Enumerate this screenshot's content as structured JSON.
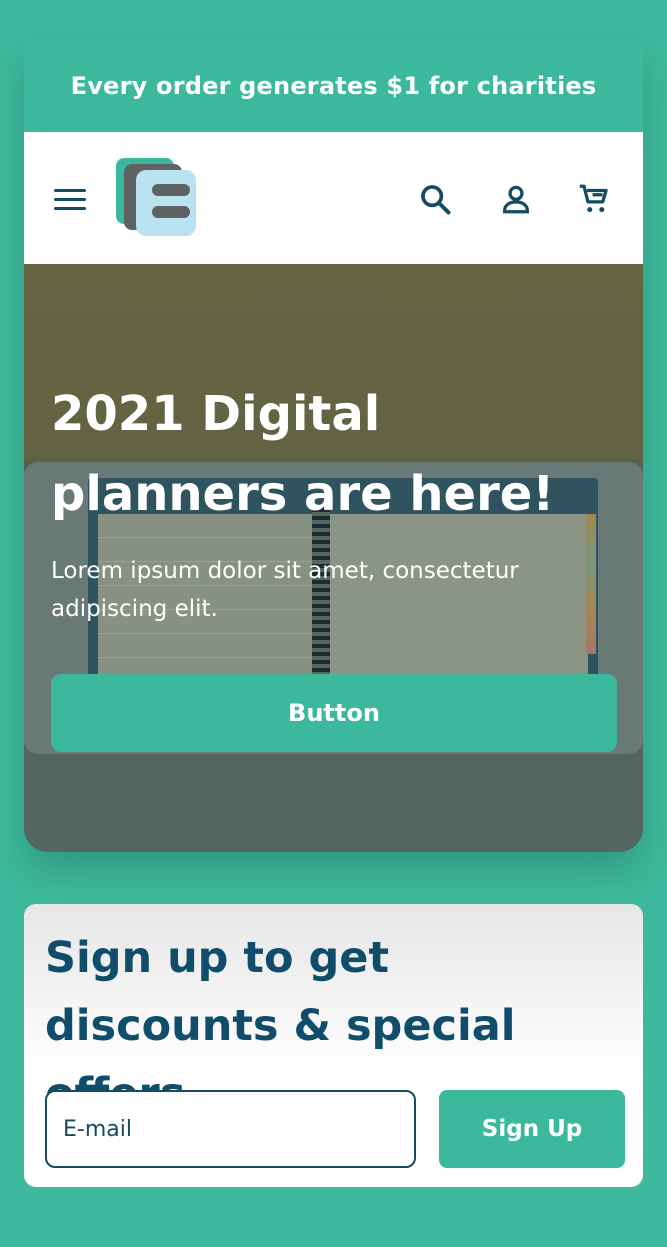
{
  "promo": {
    "text": "Every order generates $1 for charities"
  },
  "header": {
    "menu_icon": "hamburger-menu-icon",
    "logo_icon": "brand-logo",
    "search_icon": "search-icon",
    "account_icon": "user-icon",
    "cart_icon": "cart-icon"
  },
  "hero": {
    "title": "2021 Digital planners are here!",
    "subtitle": "Lorem ipsum dolor sit amet, consectetur adipiscing elit.",
    "button_label": "Button"
  },
  "signup": {
    "title": "Sign up to get discounts & special offers",
    "email_placeholder": "E-mail",
    "button_label": "Sign Up"
  },
  "colors": {
    "accent": "#3cb99d",
    "navy": "#0f4d6a",
    "white": "#ffffff"
  }
}
